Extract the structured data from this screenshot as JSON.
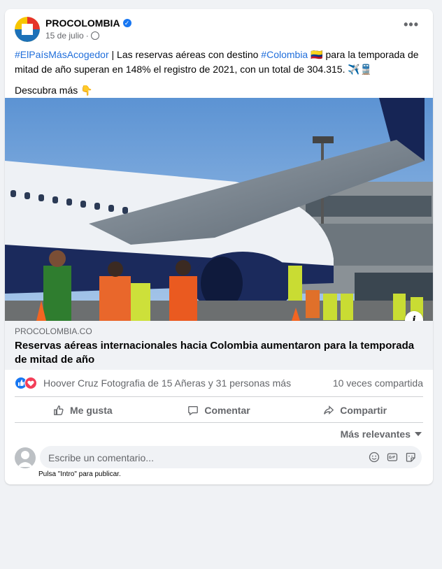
{
  "post": {
    "page_name": "PROCOLOMBIA",
    "date": "15 de julio",
    "more_label": "•••",
    "text_hashtag1": "#ElPaísMásAcogedor",
    "text_part1": " | Las reservas aéreas con destino ",
    "text_hashtag2": "#Colombia",
    "text_flag": " 🇨🇴",
    "text_part2": " para la temporada de mitad de año superan en 148% el registro de 2021, con un total de 304.315. ✈️🚆",
    "text_cta": "Descubra más 👇"
  },
  "link_preview": {
    "domain": "PROCOLOMBIA.CO",
    "title": "Reservas aéreas internacionales hacia Colombia aumentaron para la temporada de mitad de año",
    "info_label": "i"
  },
  "reactions": {
    "names": "Hoover Cruz Fotografia de 15 Añeras y 31 personas más",
    "shares": "10 veces compartida"
  },
  "actions": {
    "like": "Me gusta",
    "comment": "Comentar",
    "share": "Compartir"
  },
  "comments": {
    "sort_label": "Más relevantes",
    "placeholder": "Escribe un comentario...",
    "hint": "Pulsa \"Intro\" para publicar."
  },
  "colors": {
    "accent": "#1877f2",
    "hashtag": "#216fdb",
    "love": "#f33e58"
  }
}
